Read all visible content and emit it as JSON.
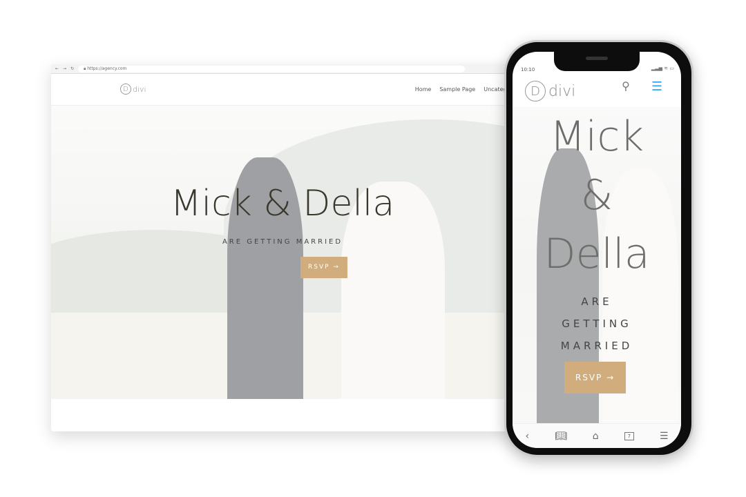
{
  "browser": {
    "url": "https://agency.com"
  },
  "site": {
    "logo_letter": "D",
    "logo_text": "divi",
    "nav": [
      "Home",
      "Sample Page",
      "Uncategori"
    ]
  },
  "hero": {
    "title": "Mick & Della",
    "subtitle": "ARE GETTING MARRIED",
    "button": "RSVP →"
  },
  "phone": {
    "time": "10:10",
    "title_lines": [
      "Mick",
      "&",
      "Della"
    ],
    "subtitle_lines": [
      "ARE",
      "GETTING",
      "MARRIED"
    ],
    "button": "RSVP →",
    "tabs_count": "7"
  },
  "colors": {
    "accent": "#d1ad7e",
    "menu": "#2ea3f2"
  }
}
